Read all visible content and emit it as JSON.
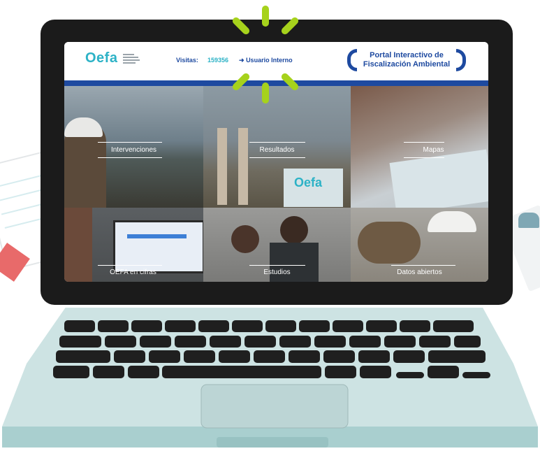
{
  "header": {
    "logo_text": "Oefa",
    "visits_label": "Visitas:",
    "visits_count": "159356",
    "login_label": "Usuario Interno",
    "portal_line1": "Portal Interactivo de",
    "portal_line2": "Fiscalización Ambiental"
  },
  "tiles": [
    {
      "label": "Intervenciones"
    },
    {
      "label": "Resultados"
    },
    {
      "label": "Mapas"
    },
    {
      "label": "OEFA en cifras"
    },
    {
      "label": "Estudios"
    },
    {
      "label": "Datos abiertos"
    }
  ],
  "colors": {
    "brand_blue": "#1e4aa0",
    "brand_teal": "#2cb2c6",
    "loader_green": "#a6d21c",
    "laptop_body": "#cde3e3"
  },
  "icons": [
    "login-arrow-icon",
    "loading-spinner-icon"
  ]
}
